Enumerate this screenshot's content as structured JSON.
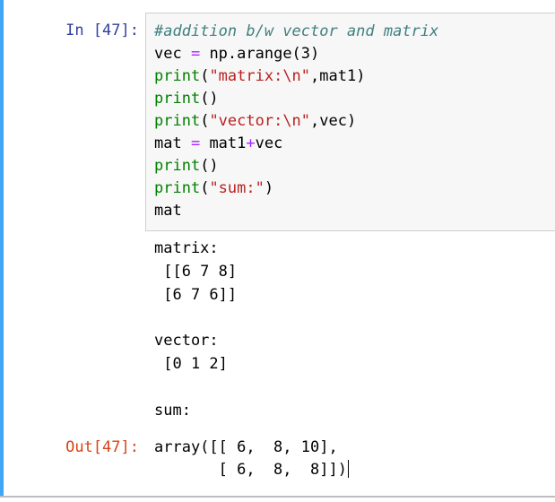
{
  "cell": {
    "in_prompt": "In [47]:",
    "out_prompt": "Out[47]:",
    "code_lines": [
      [
        {
          "text": "#addition b/w vector and matrix",
          "cls": "cm"
        }
      ],
      [
        {
          "text": "vec ",
          "cls": ""
        },
        {
          "text": "=",
          "cls": "op"
        },
        {
          "text": " np.arange(3)",
          "cls": ""
        }
      ],
      [
        {
          "text": "print",
          "cls": "bi"
        },
        {
          "text": "(",
          "cls": ""
        },
        {
          "text": "\"matrix:\\n\"",
          "cls": "st"
        },
        {
          "text": ",mat1)",
          "cls": ""
        }
      ],
      [
        {
          "text": "print",
          "cls": "bi"
        },
        {
          "text": "()",
          "cls": ""
        }
      ],
      [
        {
          "text": "print",
          "cls": "bi"
        },
        {
          "text": "(",
          "cls": ""
        },
        {
          "text": "\"vector:\\n\"",
          "cls": "st"
        },
        {
          "text": ",vec)",
          "cls": ""
        }
      ],
      [
        {
          "text": "mat ",
          "cls": ""
        },
        {
          "text": "=",
          "cls": "op"
        },
        {
          "text": " mat1",
          "cls": ""
        },
        {
          "text": "+",
          "cls": "op"
        },
        {
          "text": "vec",
          "cls": ""
        }
      ],
      [
        {
          "text": "print",
          "cls": "bi"
        },
        {
          "text": "()",
          "cls": ""
        }
      ],
      [
        {
          "text": "print",
          "cls": "bi"
        },
        {
          "text": "(",
          "cls": ""
        },
        {
          "text": "\"sum:\"",
          "cls": "st"
        },
        {
          "text": ")",
          "cls": ""
        }
      ],
      [
        {
          "text": "mat",
          "cls": ""
        }
      ]
    ],
    "stdout_lines": [
      "matrix:",
      " [[6 7 8]",
      " [6 7 6]]",
      "",
      "vector:",
      " [0 1 2]",
      "",
      "sum:"
    ],
    "result_lines": [
      "array([[ 6,  8, 10],",
      "       [ 6,  8,  8]])"
    ]
  }
}
